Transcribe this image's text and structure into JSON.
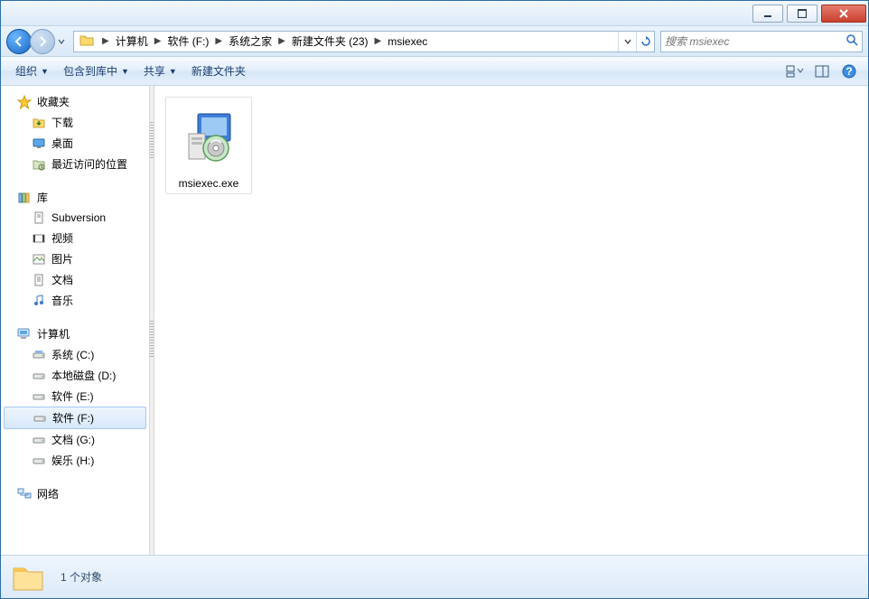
{
  "titlebar": {},
  "breadcrumb": {
    "segments": [
      "计算机",
      "软件 (F:)",
      "系统之家",
      "新建文件夹 (23)",
      "msiexec"
    ]
  },
  "search": {
    "placeholder": "搜索 msiexec"
  },
  "toolbar": {
    "organize": "组织",
    "include": "包含到库中",
    "share": "共享",
    "newfolder": "新建文件夹"
  },
  "sidebar": {
    "favorites": {
      "label": "收藏夹",
      "items": [
        "下载",
        "桌面",
        "最近访问的位置"
      ]
    },
    "libraries": {
      "label": "库",
      "items": [
        "Subversion",
        "视频",
        "图片",
        "文档",
        "音乐"
      ]
    },
    "computer": {
      "label": "计算机",
      "items": [
        "系统 (C:)",
        "本地磁盘 (D:)",
        "软件 (E:)",
        "软件 (F:)",
        "文档 (G:)",
        "娱乐 (H:)"
      ],
      "selected": 3
    },
    "network": {
      "label": "网络"
    }
  },
  "files": [
    {
      "name": "msiexec.exe"
    }
  ],
  "status": {
    "text": "1 个对象"
  }
}
